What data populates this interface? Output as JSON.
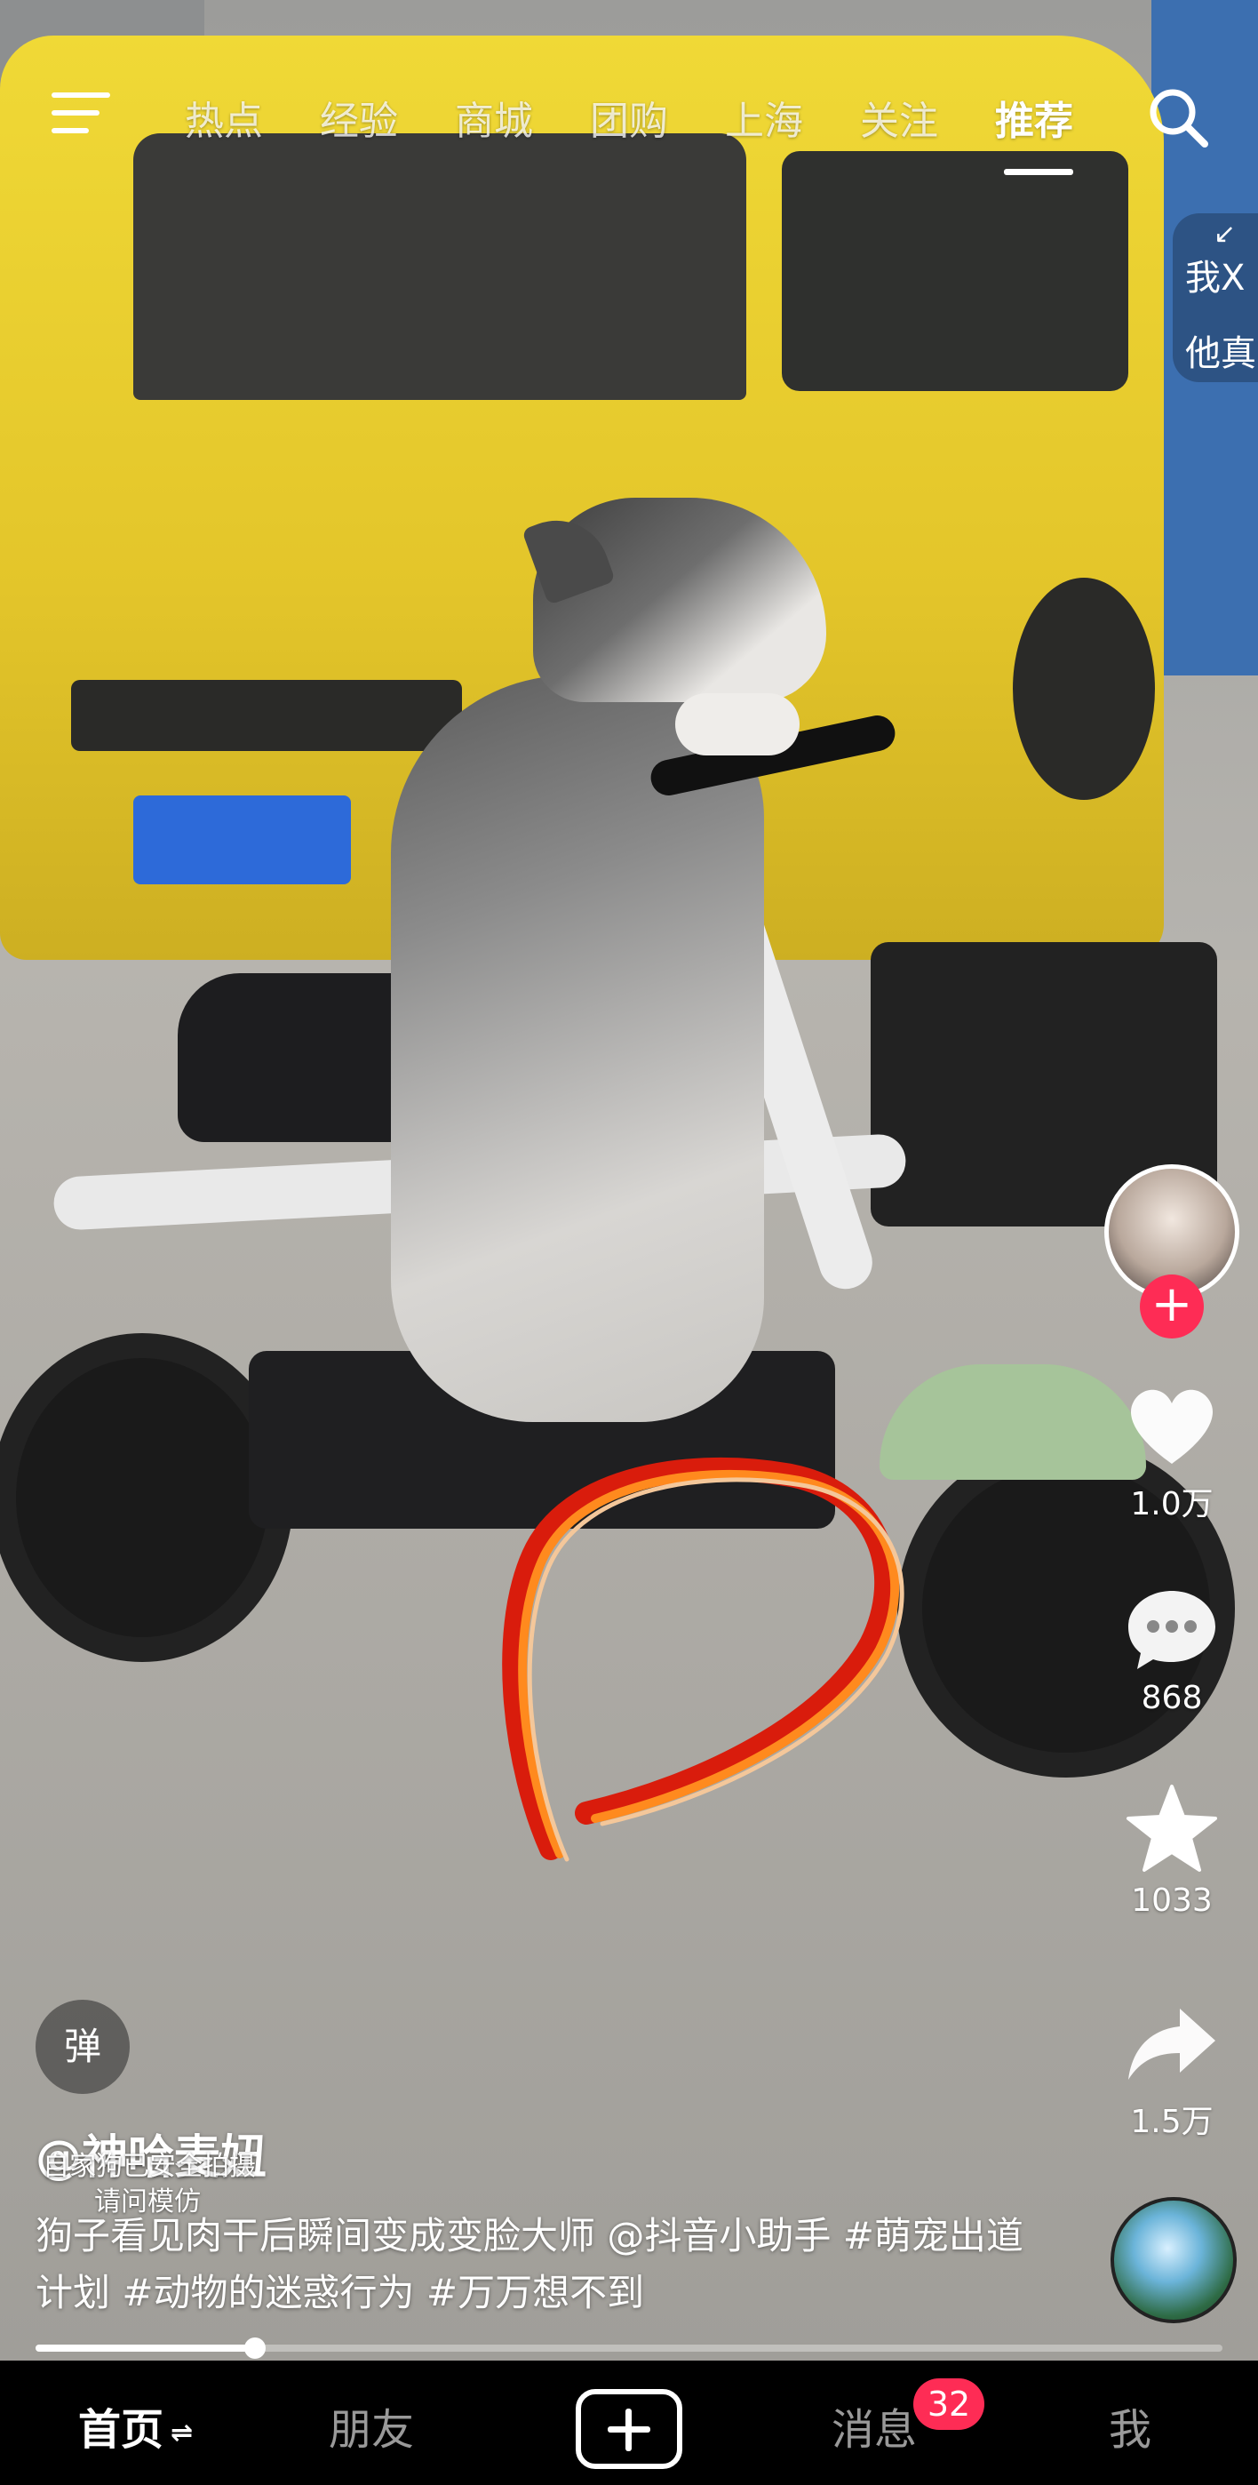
{
  "top_nav": {
    "tabs": [
      "热点",
      "经验",
      "商城",
      "团购",
      "上海",
      "关注",
      "推荐"
    ],
    "active_tab": "推荐"
  },
  "side_peek": {
    "line1": "我X",
    "line2": "他真"
  },
  "right_rail": {
    "like_count": "1.0万",
    "comment_count": "868",
    "favorite_count": "1033",
    "share_count": "1.5万"
  },
  "danmu_label": "弹",
  "post": {
    "author": "@神哈麦妞",
    "disclaimer_line1": "自家狗已安全拍摄",
    "disclaimer_line2": "请问模仿",
    "caption": "狗子看见肉干后瞬间变成变脸大师 @抖音小助手 #萌宠出道计划 #动物的迷惑行为 #万万想不到"
  },
  "progress_fraction": 0.185,
  "bottom_nav": {
    "home": "首页",
    "friends": "朋友",
    "messages": "消息",
    "messages_badge": "32",
    "me": "我"
  },
  "colors": {
    "accent": "#fe2c55"
  }
}
